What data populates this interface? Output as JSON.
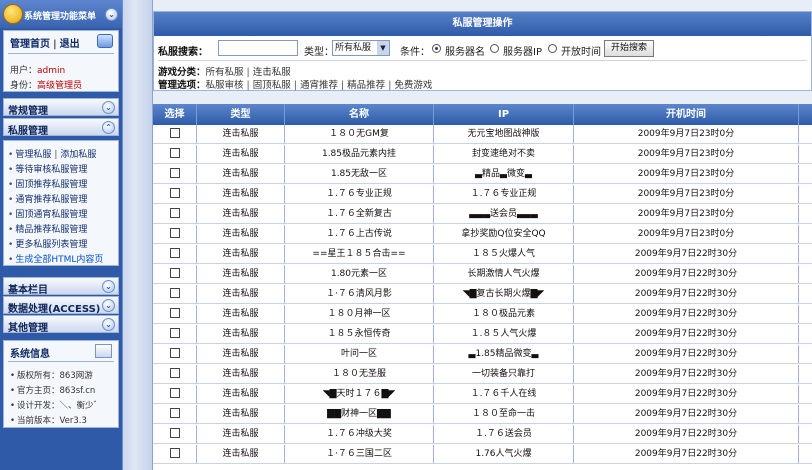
{
  "sidebar": {
    "header_title": "系统管理功能菜单",
    "user_links": {
      "home": "管理首页",
      "logout": "退出"
    },
    "user_label": "用户：",
    "user_value": "admin",
    "role_label": "身份：",
    "role_value": "高级管理员",
    "sections": {
      "common": "常规管理",
      "private": "私服管理",
      "basic": "基本栏目",
      "data": "数据处理(ACCESS)",
      "other": "其他管理"
    },
    "menu_items": [
      {
        "a": "管理私服",
        "b": "添加私服"
      },
      {
        "a": "等待审核私服管理"
      },
      {
        "a": "固顶推荐私服管理"
      },
      {
        "a": "通宵推荐私服管理"
      },
      {
        "a": "固顶通宵私服管理"
      },
      {
        "a": "精品推荐私服管理"
      },
      {
        "a": "更多私服列表管理"
      },
      {
        "a": "生成全部HTML内容页"
      }
    ],
    "info": {
      "title": "系统信息",
      "rows": [
        "版权所有：863网游",
        "官方主页：863sf.cn",
        "设计开发：＼、衡少゛",
        "当前版本：Ver3.3"
      ]
    }
  },
  "search": {
    "title": "私服管理操作",
    "keyword_label": "私服搜索：",
    "keyword_value": "",
    "type_label": "类型：",
    "type_selected": "所有私服",
    "condition_label": "条件：",
    "options": [
      "服务器名",
      "服务器IP",
      "开放时间"
    ],
    "selected_option": 0,
    "button": "开始搜索",
    "category_label": "游戏分类：",
    "categories": [
      "所有私服",
      "连击私服"
    ],
    "manage_label": "管理选项：",
    "manage_options": [
      "私服审核",
      "固顶私服",
      "通宵推荐",
      "精品推荐",
      "免费游戏"
    ]
  },
  "table": {
    "headers": [
      "选择",
      "类型",
      "名称",
      "IP",
      "开机时间"
    ],
    "rows": [
      [
        "连击私服",
        "１８０无GM复",
        "无元宝地图战神版",
        "2009年9月7日23时0分"
      ],
      [
        "连击私服",
        "1.85极品元素内挂",
        "封变速绝对不卖",
        "2009年9月7日23时0分"
      ],
      [
        "连击私服",
        "1.85无敌一区",
        "▃精品▃微变▃",
        "2009年9月7日23时0分"
      ],
      [
        "连击私服",
        "１.７６专业正规",
        "１.７６专业正规",
        "2009年9月7日23时0分"
      ],
      [
        "连击私服",
        "１.７６全新复古",
        "▃▃▃送会员▃▃▃",
        "2009年9月7日23时0分"
      ],
      [
        "连击私服",
        "１.７６上古传说",
        "拿抄奖励Q位安全QQ",
        "2009年9月7日23时0分"
      ],
      [
        "连击私服",
        "==星王１８５合击==",
        "１８５火爆人气",
        "2009年9月7日22时30分"
      ],
      [
        "连击私服",
        "1.80元素一区",
        "长期激情人气火爆",
        "2009年9月7日22时30分"
      ],
      [
        "连击私服",
        "１·７６清风月影",
        "◥▇复古长期火爆▇◤",
        "2009年9月7日22时30分"
      ],
      [
        "连击私服",
        "１８０月神一区",
        "１８０极品元素",
        "2009年9月7日22时30分"
      ],
      [
        "连击私服",
        "１８５永恒传奇",
        "１.８５人气火爆",
        "2009年9月7日22时30分"
      ],
      [
        "连击私服",
        "叶问一区",
        "▃1.85精品微变▃",
        "2009年9月7日22时30分"
      ],
      [
        "连击私服",
        "１８０无圣服",
        "一切装备只靠打",
        "2009年9月7日22时30分"
      ],
      [
        "连击私服",
        "◥▇天时１７６▇◤",
        "１.７６千人在线",
        "2009年9月7日22时30分"
      ],
      [
        "连击私服",
        "▇▇财神一区▇▇",
        "１８０至命一击",
        "2009年9月7日22时30分"
      ],
      [
        "连击私服",
        "１.７６冲级大奖",
        "１.７６送会员",
        "2009年9月7日22时30分"
      ],
      [
        "连击私服",
        "１·７６三国二区",
        "1.76人气火爆",
        "2009年9月7日22时30分"
      ]
    ]
  }
}
